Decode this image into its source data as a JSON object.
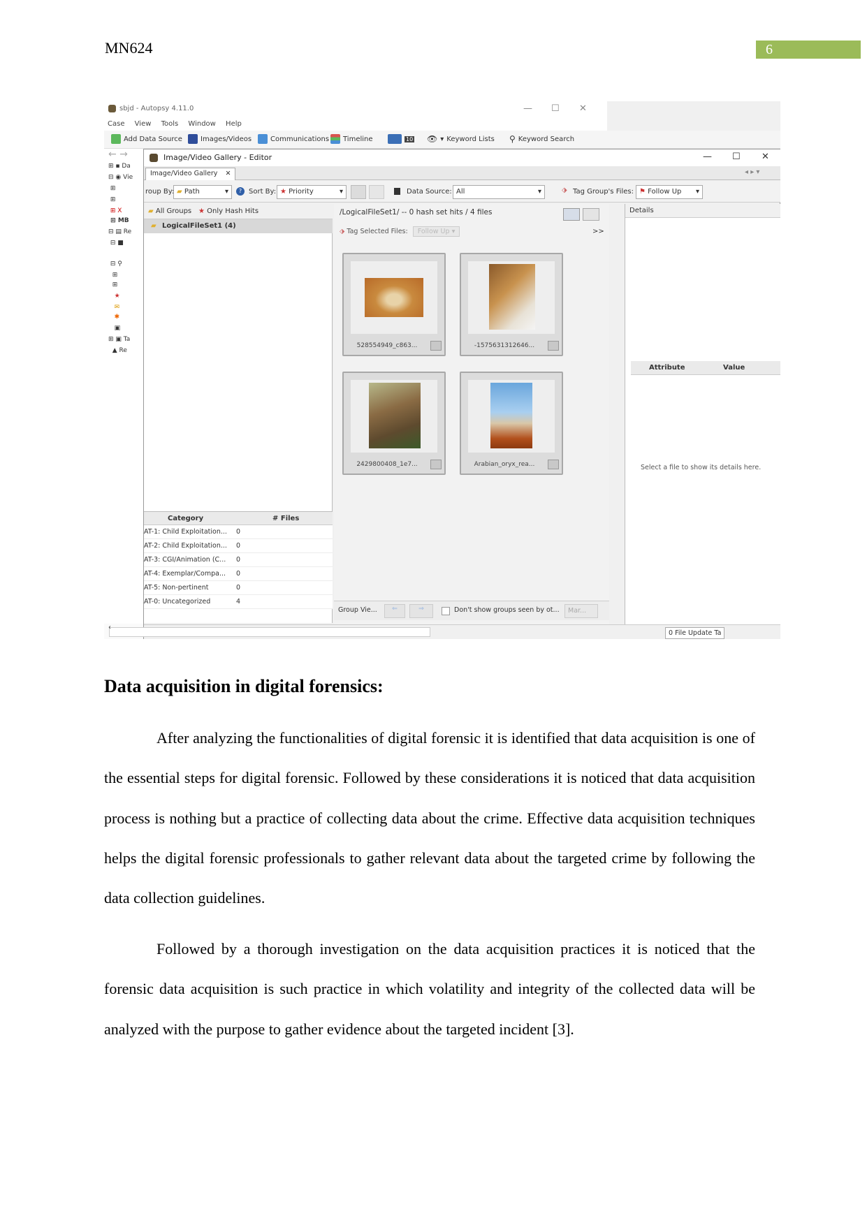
{
  "page": {
    "header": "MN624",
    "page_number": "6"
  },
  "screenshot": {
    "app_title": "sbjd - Autopsy 4.11.0",
    "menu": [
      "Case",
      "View",
      "Tools",
      "Window",
      "Help"
    ],
    "toolbar": [
      "Add Data Source",
      "Images/Videos",
      "Communications",
      "Timeline",
      "Keyword Lists",
      "Keyword Search"
    ],
    "mail_badge": "10",
    "tree_labels": [
      "Da",
      "Vie",
      "X",
      "MB",
      "Re",
      "Ta",
      "Re"
    ],
    "editor_title": "Image/Video Gallery - Editor",
    "tab_label": "Image/Video Gallery",
    "group_by_label": "roup By:",
    "group_by_value": "Path",
    "sort_by_label": "Sort By:",
    "sort_by_value": "Priority",
    "data_source_label": "Data Source:",
    "data_source_value": "All",
    "tag_group_label": "Tag Group's Files:",
    "tag_group_value": "Follow Up",
    "left_tabs": [
      "All Groups",
      "Only Hash Hits"
    ],
    "selected_group": "LogicalFileSet1 (4)",
    "category_header": "Category",
    "files_header": "# Files",
    "categories": [
      {
        "name": "AT-1: Child Exploitation...",
        "count": "0"
      },
      {
        "name": "AT-2: Child Exploitation...",
        "count": "0"
      },
      {
        "name": "AT-3: CGI/Animation (C...",
        "count": "0"
      },
      {
        "name": "AT-4: Exemplar/Compa...",
        "count": "0"
      },
      {
        "name": "AT-5: Non-pertinent",
        "count": "0"
      },
      {
        "name": "AT-0: Uncategorized",
        "count": "4"
      }
    ],
    "path_text": "/LogicalFileSet1/ -- 0 hash set hits / 4 files",
    "tag_selected_label": "Tag Selected Files:",
    "tag_selected_value": "Follow Up",
    "more_arrows": ">>",
    "thumbnails": [
      {
        "caption": "528554949_c863..."
      },
      {
        "caption": "-1575631312646..."
      },
      {
        "caption": "2429800408_1e7..."
      },
      {
        "caption": "Arabian_oryx_rea..."
      }
    ],
    "group_view_label": "Group Vie...",
    "dont_show_label": "Don't show groups seen by ot...",
    "mark_label": "Mar...",
    "details_header": "Details",
    "attribute_header": "Attribute",
    "value_header": "Value",
    "details_message": "Select a file to show its details here.",
    "status_text": "0 File Update Ta"
  },
  "document": {
    "heading": "Data acquisition in digital forensics:",
    "paragraphs": [
      "After analyzing the functionalities of digital forensic it is identified that data acquisition is one of the essential steps for digital forensic. Followed by these considerations it is noticed that data acquisition process is nothing but a practice of collecting data about the crime. Effective data acquisition techniques helps the digital forensic professionals to gather relevant data about the targeted crime by following the data collection guidelines.",
      "Followed by a thorough investigation on the data acquisition practices it is noticed that the forensic data acquisition is such practice in which volatility and integrity of the collected data will be analyzed with the purpose to gather evidence about the targeted incident [3]."
    ]
  }
}
